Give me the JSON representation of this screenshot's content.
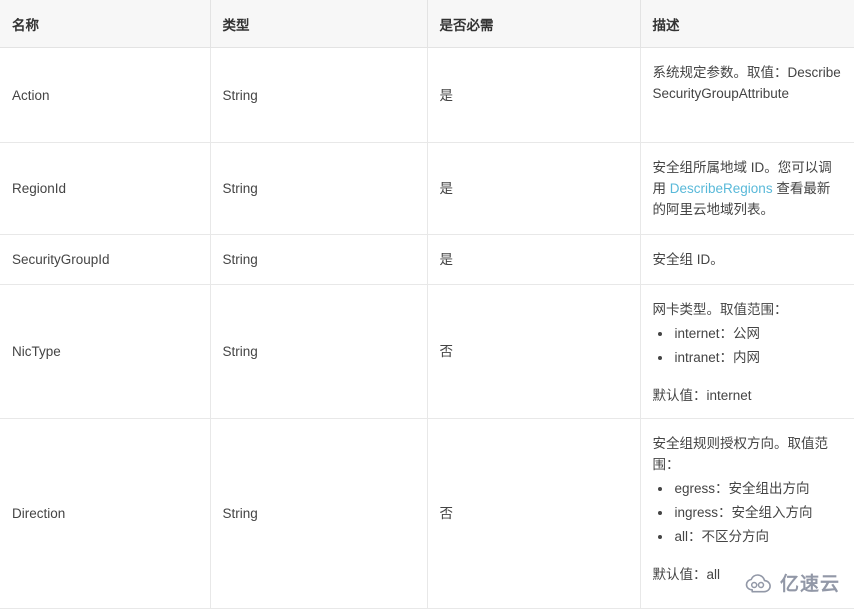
{
  "table": {
    "headers": [
      "名称",
      "类型",
      "是否必需",
      "描述"
    ],
    "rows": [
      {
        "name": "Action",
        "type": "String",
        "required": "是",
        "desc": {
          "lead": "系统规定参数。取值：DescribeSecurityGroupAttribute",
          "bullets": [],
          "default": ""
        }
      },
      {
        "name": "RegionId",
        "type": "String",
        "required": "是",
        "desc": {
          "lead_before_link": "安全组所属地域 ID。您可以调用 ",
          "link_text": "DescribeRegions",
          "lead_after_link": " 查看最新的阿里云地域列表。",
          "bullets": [],
          "default": ""
        }
      },
      {
        "name": "SecurityGroupId",
        "type": "String",
        "required": "是",
        "desc": {
          "lead": "安全组 ID。",
          "bullets": [],
          "default": ""
        }
      },
      {
        "name": "NicType",
        "type": "String",
        "required": "否",
        "desc": {
          "lead": "网卡类型。取值范围：",
          "bullets": [
            "internet：公网",
            "intranet：内网"
          ],
          "default": "默认值：internet"
        }
      },
      {
        "name": "Direction",
        "type": "String",
        "required": "否",
        "desc": {
          "lead": "安全组规则授权方向。取值范围：",
          "bullets": [
            "egress：安全组出方向",
            "ingress：安全组入方向",
            "all：不区分方向"
          ],
          "default": "默认值：all"
        }
      }
    ]
  },
  "watermark": {
    "text": "亿速云"
  },
  "colors": {
    "link": "#59b9d9",
    "header_bg": "#f7f7f7",
    "border": "#e8e8e8",
    "text": "#444444",
    "watermark": "#8d93a3"
  }
}
